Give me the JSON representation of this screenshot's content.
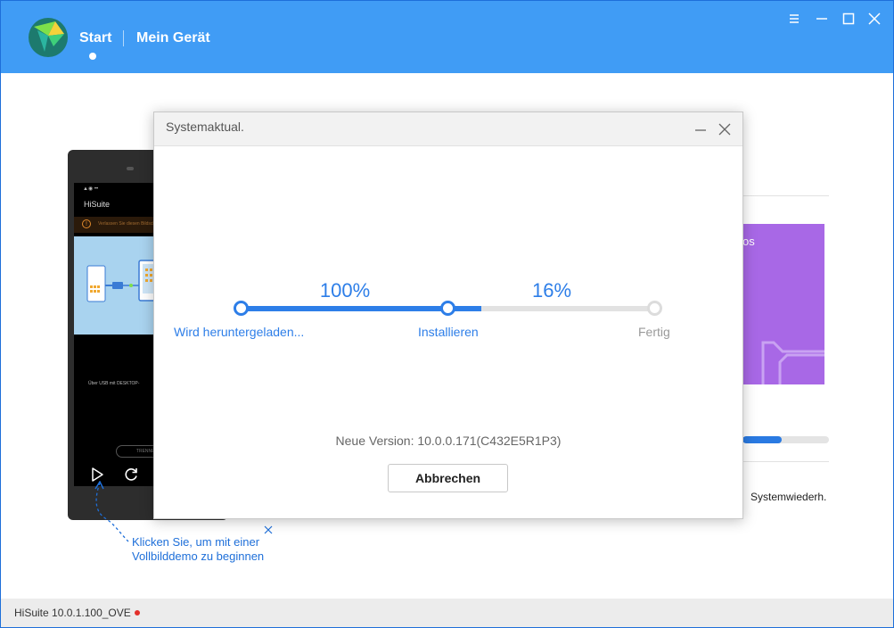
{
  "header": {
    "nav_start": "Start",
    "nav_device": "Mein Gerät",
    "accent_color": "#409cf5"
  },
  "phone_demo": {
    "screen_status": "▲◉ ••",
    "screen_title": "HiSuite",
    "screen_warning": "Verlassen Sie diesen Bildschirm nicht",
    "screen_usb_text": "Über USB mit DESKTOP-",
    "screen_button": "TRENNEN",
    "tip_text": "Klicken Sie, um mit einer Vollbilddemo zu beginnen"
  },
  "background_panel": {
    "promo_text": "os",
    "progress_fraction": 0.45,
    "restore_label": "Systemwiederh."
  },
  "dialog": {
    "title": "Systemaktual.",
    "steps": [
      {
        "label": "Wird heruntergeladen...",
        "state": "done"
      },
      {
        "label": "Installieren",
        "state": "active"
      },
      {
        "label": "Fertig",
        "state": "pending"
      }
    ],
    "download_percent": "100%",
    "install_percent": "16%",
    "install_progress": 0.16,
    "version": "Neue Version: 10.0.0.171(C432E5R1P3)",
    "cancel_label": "Abbrechen",
    "active_color": "#2d7ee8",
    "pending_color": "#9a9a9a"
  },
  "statusbar": {
    "version_text": "HiSuite 10.0.1.100_OVE",
    "status_dot_color": "#e3302b"
  }
}
